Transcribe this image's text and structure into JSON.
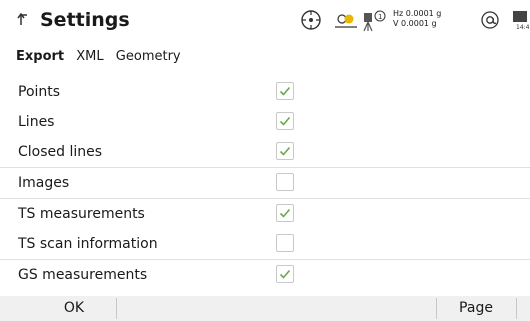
{
  "header": {
    "title": "Settings",
    "hz": "Hz 0.0001 g",
    "v": "V  0.0001 g",
    "time": "14:4",
    "icons": [
      "back-icon",
      "compass-icon",
      "target-icon",
      "instrument-icon",
      "at-icon",
      "battery-icon"
    ]
  },
  "tabs": [
    {
      "label": "Export",
      "active": true
    },
    {
      "label": "XML",
      "active": false
    },
    {
      "label": "Geometry",
      "active": false
    }
  ],
  "rows": [
    {
      "label": "Points",
      "checked": true
    },
    {
      "label": "Lines",
      "checked": true
    },
    {
      "label": "Closed lines",
      "checked": true
    },
    {
      "label": "Images",
      "checked": false
    },
    {
      "label": "TS measurements",
      "checked": true
    },
    {
      "label": "TS scan information",
      "checked": false
    },
    {
      "label": "GS measurements",
      "checked": true
    }
  ],
  "footer": {
    "ok_label": "OK",
    "page_label": "Page"
  },
  "colors": {
    "check": "#6aa84f",
    "accent": "#e8b800"
  }
}
